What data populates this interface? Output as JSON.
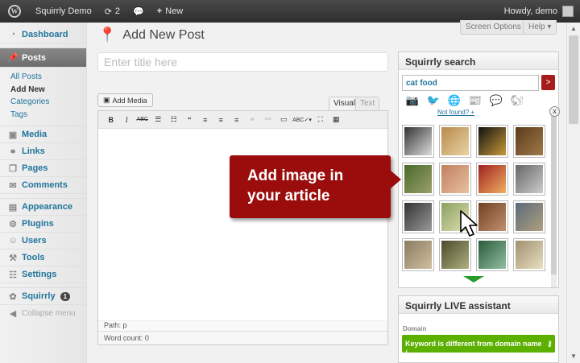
{
  "adminbar": {
    "site_name": "Squirrly Demo",
    "updates_count": "2",
    "new_label": "New",
    "greeting": "Howdy, demo"
  },
  "sidebar": {
    "items": [
      {
        "label": "Dashboard",
        "icon": "dashboard-icon"
      },
      {
        "label": "Posts",
        "icon": "pin-icon"
      },
      {
        "label": "Media",
        "icon": "media-icon"
      },
      {
        "label": "Links",
        "icon": "links-icon"
      },
      {
        "label": "Pages",
        "icon": "pages-icon"
      },
      {
        "label": "Comments",
        "icon": "comments-icon"
      },
      {
        "label": "Appearance",
        "icon": "appearance-icon"
      },
      {
        "label": "Plugins",
        "icon": "plugins-icon"
      },
      {
        "label": "Users",
        "icon": "users-icon"
      },
      {
        "label": "Tools",
        "icon": "tools-icon"
      },
      {
        "label": "Settings",
        "icon": "settings-icon"
      },
      {
        "label": "Squirrly",
        "icon": "squirrly-icon",
        "badge": "1"
      }
    ],
    "posts_submenu": [
      "All Posts",
      "Add New",
      "Categories",
      "Tags"
    ],
    "collapse_label": "Collapse menu"
  },
  "header": {
    "screen_options": "Screen Options",
    "help": "Help",
    "page_title": "Add New Post"
  },
  "editor": {
    "title_placeholder": "Enter title here",
    "add_media": "Add Media",
    "tab_visual": "Visual",
    "tab_text": "Text",
    "path": "Path: p",
    "word_count": "Word count: 0"
  },
  "callout": {
    "line1": "Add image in",
    "line2": "your article",
    "color": "#9b0d0d"
  },
  "squirrly_search": {
    "title": "Squirrly search",
    "query": "cat food",
    "go_label": ">",
    "close_label": "x",
    "more_link": "Not found? +",
    "source_icons": [
      "camera-icon",
      "twitter-icon",
      "wikipedia-icon",
      "news-icon",
      "chat-icon",
      "squirrel-icon"
    ]
  },
  "squirrly_live": {
    "title": "Squirrly LIVE assistant",
    "section": "Domain",
    "keyword_status": "Keyword is different from domain name",
    "status_color": "#5cb000"
  }
}
